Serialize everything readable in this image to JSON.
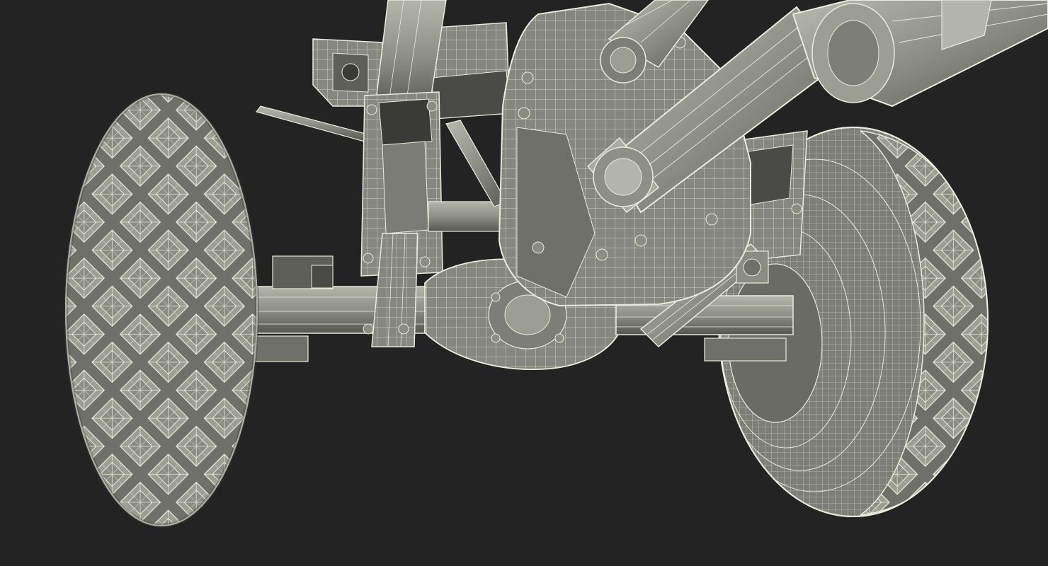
{
  "scene": {
    "subject": "wireframe-render-axle-suspension",
    "colors": {
      "background": "#232323",
      "surface": "#8b8c82",
      "surface_light": "#a9aaa0",
      "surface_dark": "#5c5d56",
      "shadow": "#3a3b37",
      "wire": "#e9ebdc"
    },
    "icons": [
      "tire-icon",
      "axle-icon",
      "differential-icon",
      "drive-shaft-icon",
      "suspension-icon"
    ]
  }
}
